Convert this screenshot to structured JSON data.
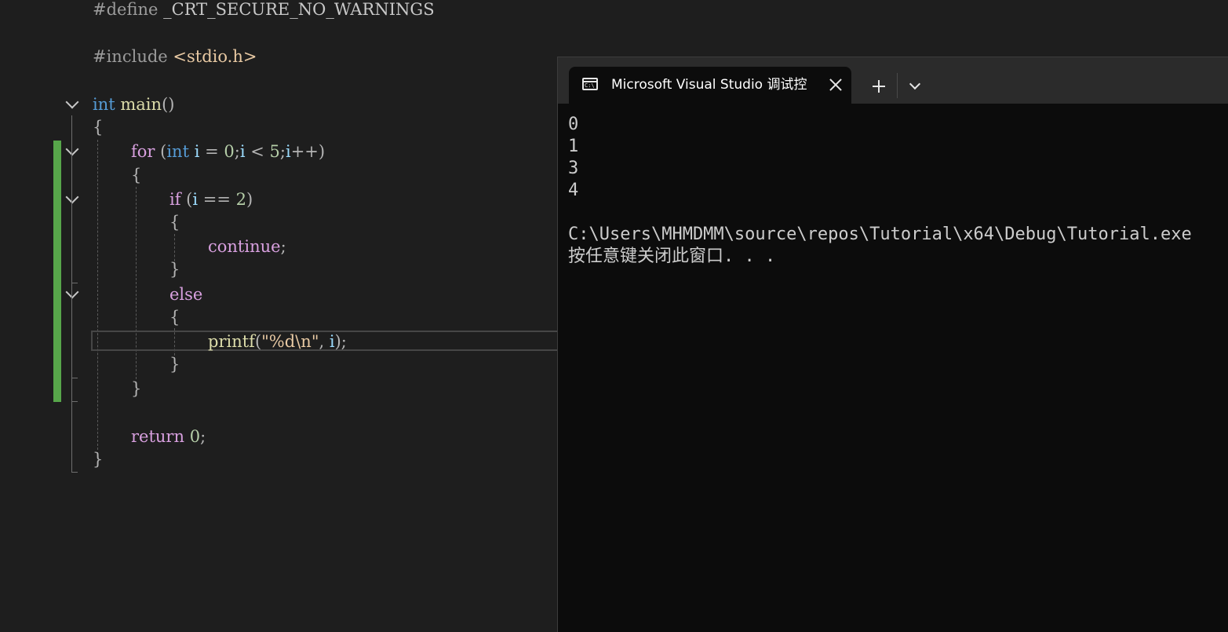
{
  "editor": {
    "lines": [
      [
        [
          "#define",
          "pre"
        ],
        [
          " ",
          "pun"
        ],
        [
          "_CRT_SECURE_NO_WARNINGS",
          "macro"
        ]
      ],
      [
        [
          "#include",
          "pre"
        ],
        [
          " ",
          "pun"
        ],
        [
          "<stdio.h>",
          "inc"
        ]
      ],
      [
        [
          "int",
          "key"
        ],
        [
          " ",
          "pun"
        ],
        [
          "main",
          "fn"
        ],
        [
          "()",
          "pun"
        ]
      ],
      [
        [
          "{",
          "pun"
        ]
      ],
      [
        [
          "for",
          "ctl"
        ],
        [
          " (",
          "pun"
        ],
        [
          "int",
          "key"
        ],
        [
          " ",
          "pun"
        ],
        [
          "i",
          "var"
        ],
        [
          " = ",
          "op"
        ],
        [
          "0",
          "num"
        ],
        [
          ";",
          "pun"
        ],
        [
          "i",
          "var"
        ],
        [
          " < ",
          "op"
        ],
        [
          "5",
          "num"
        ],
        [
          ";",
          "pun"
        ],
        [
          "i",
          "var"
        ],
        [
          "++)",
          "op"
        ]
      ],
      [
        [
          "{",
          "pun"
        ]
      ],
      [
        [
          "if",
          "ctl"
        ],
        [
          " (",
          "pun"
        ],
        [
          "i",
          "var"
        ],
        [
          " == ",
          "op"
        ],
        [
          "2",
          "num"
        ],
        [
          ")",
          "pun"
        ]
      ],
      [
        [
          "{",
          "pun"
        ]
      ],
      [
        [
          "continue",
          "ctl"
        ],
        [
          ";",
          "pun"
        ]
      ],
      [
        [
          "}",
          "pun"
        ]
      ],
      [
        [
          "else",
          "ctl"
        ]
      ],
      [
        [
          "{",
          "pun"
        ]
      ],
      [
        [
          "printf",
          "fn"
        ],
        [
          "(",
          "pun"
        ],
        [
          "\"%d",
          "str"
        ],
        [
          "\\n",
          "esc"
        ],
        [
          "\"",
          "str"
        ],
        [
          ", ",
          "pun"
        ],
        [
          "i",
          "var"
        ],
        [
          ");",
          "pun"
        ]
      ],
      [
        [
          "}",
          "pun"
        ]
      ],
      [
        [
          "}",
          "pun"
        ]
      ],
      [
        [
          "return",
          "ctl"
        ],
        [
          " ",
          "pun"
        ],
        [
          "0",
          "num"
        ],
        [
          ";",
          "pun"
        ]
      ],
      [
        [
          "}",
          "pun"
        ]
      ]
    ]
  },
  "terminal": {
    "tab_title": "Microsoft Visual Studio 调试控",
    "tab_icon": "command-prompt-icon",
    "icon_text": "C:\\",
    "output_lines": [
      "0",
      "1",
      "3",
      "4",
      "",
      "C:\\Users\\MHMDMM\\source\\repos\\Tutorial\\x64\\Debug\\Tutorial.exe",
      "按任意键关闭此窗口. . ."
    ]
  },
  "colors": {
    "editor_bg": "#1e1e1e",
    "terminal_bg": "#0c0c0c",
    "tabbar_bg": "#2b2b2b",
    "change_bar": "#57a64a"
  }
}
